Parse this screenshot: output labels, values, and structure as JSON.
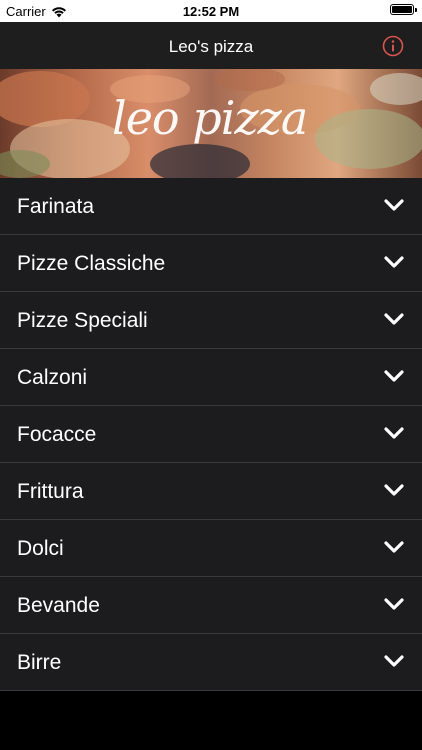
{
  "status_bar": {
    "carrier": "Carrier",
    "time": "12:52 PM"
  },
  "nav_bar": {
    "title": "Leo's pizza",
    "info_icon": "info-icon",
    "accent_color": "#d9534f"
  },
  "banner": {
    "logo_text": "leo pizza"
  },
  "menu": {
    "items": [
      {
        "label": "Farinata"
      },
      {
        "label": "Pizze Classiche"
      },
      {
        "label": "Pizze Speciali"
      },
      {
        "label": "Calzoni"
      },
      {
        "label": "Focacce"
      },
      {
        "label": "Frittura"
      },
      {
        "label": "Dolci"
      },
      {
        "label": "Bevande"
      },
      {
        "label": "Birre"
      }
    ],
    "expand_icon": "chevron-down-icon"
  }
}
